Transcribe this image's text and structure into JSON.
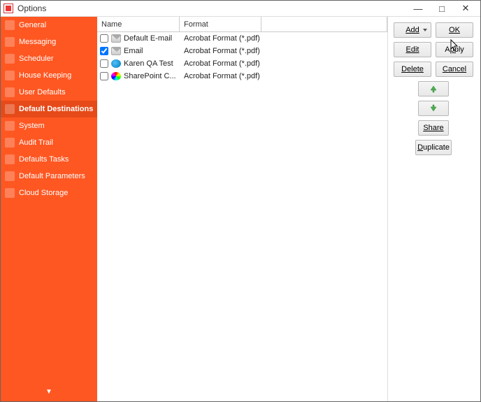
{
  "window": {
    "title": "Options"
  },
  "sidebar": {
    "items": [
      {
        "label": "General",
        "icon": "general-icon"
      },
      {
        "label": "Messaging",
        "icon": "messaging-icon"
      },
      {
        "label": "Scheduler",
        "icon": "scheduler-icon"
      },
      {
        "label": "House Keeping",
        "icon": "housekeeping-icon"
      },
      {
        "label": "User Defaults",
        "icon": "userdefaults-icon"
      },
      {
        "label": "Default Destinations",
        "icon": "destinations-icon",
        "active": true
      },
      {
        "label": "System",
        "icon": "system-icon"
      },
      {
        "label": "Audit Trail",
        "icon": "audittrail-icon"
      },
      {
        "label": "Defaults Tasks",
        "icon": "defaulttasks-icon"
      },
      {
        "label": "Default Parameters",
        "icon": "defaultparams-icon"
      },
      {
        "label": "Cloud Storage",
        "icon": "cloudstorage-icon"
      }
    ]
  },
  "list": {
    "columns": {
      "name": "Name",
      "format": "Format"
    },
    "rows": [
      {
        "checked": false,
        "iconClass": "mail",
        "icon": "mail-icon",
        "name": "Default E-mail",
        "format": "Acrobat Format (*.pdf)"
      },
      {
        "checked": true,
        "iconClass": "mail",
        "icon": "mail-icon",
        "name": "Email",
        "format": "Acrobat Format (*.pdf)"
      },
      {
        "checked": false,
        "iconClass": "globe",
        "icon": "globe-icon",
        "name": "Karen QA Test",
        "format": "Acrobat Format (*.pdf)"
      },
      {
        "checked": false,
        "iconClass": "color",
        "icon": "sharepoint-icon",
        "name": "SharePoint C...",
        "format": "Acrobat Format (*.pdf)"
      }
    ]
  },
  "buttons": {
    "add": "Add",
    "ok": "OK",
    "edit": "Edit",
    "apply": "Apply",
    "delete": "Delete",
    "cancel": "Cancel",
    "share": "Share",
    "duplicate": "Duplicate"
  }
}
